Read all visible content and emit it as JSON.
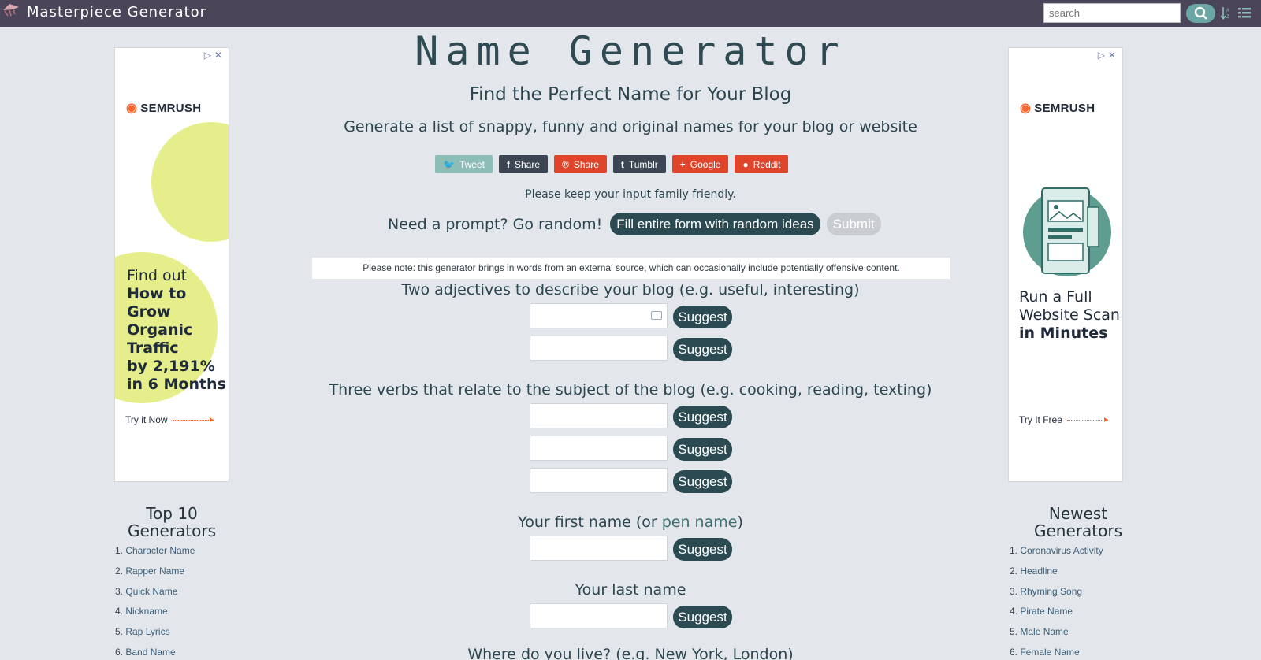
{
  "topbar": {
    "brand": "Masterpiece Generator",
    "search_placeholder": "search",
    "icons": [
      "logo-icon",
      "search-icon",
      "sort-icon",
      "list-icon"
    ]
  },
  "ads": {
    "left": {
      "brand": "SEMRUSH",
      "headline_1": "Find out",
      "headline_2": "How to Grow",
      "headline_3": "Organic",
      "headline_4": "Traffic",
      "headline_5": "by 2,191%",
      "headline_6": "in 6 Months",
      "cta": "Try it Now"
    },
    "right": {
      "brand": "SEMRUSH",
      "headline_1": "Run a Full",
      "headline_2": "Website Scan",
      "headline_3": "in Minutes",
      "cta": "Try It Free"
    },
    "close_glyph": "▷✕"
  },
  "main": {
    "title": "Name Generator",
    "subtitle": "Find the Perfect Name for Your Blog",
    "intro": "Generate a list of snappy, funny and original names for your blog or website",
    "share": [
      {
        "label": "Tweet",
        "icon": "twitter-icon",
        "glyph": "🐦",
        "color": "#8dbdb7"
      },
      {
        "label": "Share",
        "icon": "facebook-icon",
        "glyph": "f",
        "color": "#3b4652"
      },
      {
        "label": "Share",
        "icon": "pinterest-icon",
        "glyph": "℗",
        "color": "#e0452c"
      },
      {
        "label": "Tumblr",
        "icon": "tumblr-icon",
        "glyph": "t",
        "color": "#3b4652"
      },
      {
        "label": "Google",
        "icon": "google-plus-icon",
        "glyph": "+",
        "color": "#e0452c"
      },
      {
        "label": "Reddit",
        "icon": "reddit-icon",
        "glyph": "●",
        "color": "#e0452c"
      }
    ],
    "family_note": "Please keep your input family friendly.",
    "prompt_label": "Need a prompt? Go random!",
    "fill_button": "Fill entire form with random ideas",
    "submit_button": "Submit",
    "warning": "Please note: this generator brings in words from an external source, which can occasionally include potentially offensive content.",
    "q1": "Two adjectives to describe your blog (e.g. useful, interesting)",
    "q2": "Three verbs that relate to the subject of the blog (e.g. cooking, reading, texting)",
    "q3_a": "Your first name (or ",
    "q3_link": "pen name",
    "q3_b": ")",
    "q4": "Your last name",
    "q5": "Where do you live? (e.g. New York, London)",
    "suggest_label": "Suggest"
  },
  "top10": {
    "title_1": "Top 10",
    "title_2": "Generators",
    "items": [
      "Character Name",
      "Rapper Name",
      "Quick Name",
      "Nickname",
      "Rap Lyrics",
      "Band Name"
    ]
  },
  "newest": {
    "title_1": "Newest",
    "title_2": "Generators",
    "items": [
      "Coronavirus Activity",
      "Headline",
      "Rhyming Song",
      "Pirate Name",
      "Male Name",
      "Female Name"
    ]
  }
}
